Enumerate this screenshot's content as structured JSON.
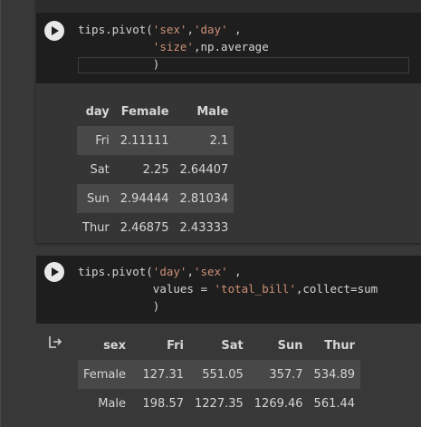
{
  "cell1": {
    "code": {
      "line1_prefix": "tips.pivot(",
      "line1_str_sex": "'sex'",
      "line1_comma": ",",
      "line1_str_day": "'day'",
      "line1_tail": " ,",
      "line2_indent": "           ",
      "line2_str": "'size'",
      "line2_tail": ",np.average",
      "line3_indent": "           ",
      "line3_paren": ")"
    },
    "table": {
      "index_name": "day",
      "columns": [
        "Female",
        "Male"
      ],
      "rows": [
        {
          "label": "Fri",
          "values": [
            "2.11111",
            "2.1"
          ]
        },
        {
          "label": "Sat",
          "values": [
            "2.25",
            "2.64407"
          ]
        },
        {
          "label": "Sun",
          "values": [
            "2.94444",
            "2.81034"
          ]
        },
        {
          "label": "Thur",
          "values": [
            "2.46875",
            "2.43333"
          ]
        }
      ]
    }
  },
  "cell2": {
    "code": {
      "line1_prefix": "tips.pivot(",
      "line1_str_day": "'day'",
      "line1_comma": ",",
      "line1_str_sex": "'sex'",
      "line1_tail": " ,",
      "line2_indent": "           ",
      "line2_kw": "values = ",
      "line2_str": "'total_bill'",
      "line2_tail": ",collect=sum",
      "line3_indent": "           ",
      "line3_paren": ")"
    },
    "table": {
      "index_name": "sex",
      "columns": [
        "Fri",
        "Sat",
        "Sun",
        "Thur"
      ],
      "rows": [
        {
          "label": "Female",
          "values": [
            "127.31",
            "551.05",
            "357.7",
            "534.89"
          ]
        },
        {
          "label": "Male",
          "values": [
            "198.57",
            "1227.35",
            "1269.46",
            "561.44"
          ]
        }
      ]
    }
  },
  "icons": {
    "run": "play-icon",
    "output": "output-redirect-icon"
  },
  "colors": {
    "string": "#ce9178",
    "code_bg": "#1e1e1e",
    "page_bg": "#383838"
  }
}
